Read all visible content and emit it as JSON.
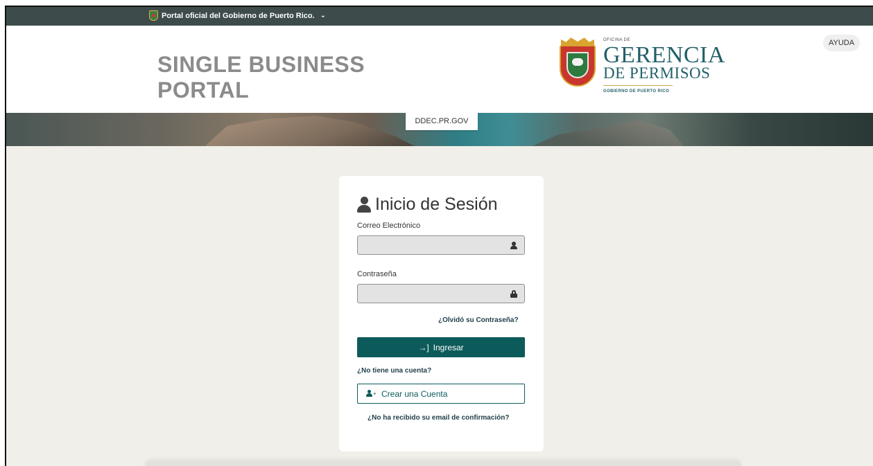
{
  "topbar": {
    "gov_link_label": "Portal oficial del Gobierno de Puerto Rico.",
    "dropdown_icon": "chevron-down-icon",
    "emblem_icon": "puerto-rico-seal-icon"
  },
  "header": {
    "title_line1": "SINGLE BUSINESS",
    "title_line2": "PORTAL",
    "agency_small": "OFICINA DE",
    "agency_big": "GERENCIA",
    "agency_mid": "DE PERMISOS",
    "agency_foot": "GOBIERNO DE PUERTO RICO",
    "help_label": "AYUDA"
  },
  "banner": {
    "ddec_label": "DDEC.PR.GOV"
  },
  "login": {
    "title": "Inicio de Sesión",
    "email_label": "Correo Electrónico",
    "email_value": "",
    "password_label": "Contraseña",
    "password_value": "",
    "forgot_password": "¿Olvidó su Contraseña?",
    "signin_button": "Ingresar",
    "no_account": "¿No tiene una cuenta?",
    "create_account_button": "Crear una Cuenta",
    "no_confirmation": "¿No ha recibido su email de confirmación?"
  },
  "colors": {
    "primary": "#0d5a5a",
    "topbar": "#3d4b4b",
    "page_bg": "#f1efe9",
    "agency_text": "#236069"
  }
}
